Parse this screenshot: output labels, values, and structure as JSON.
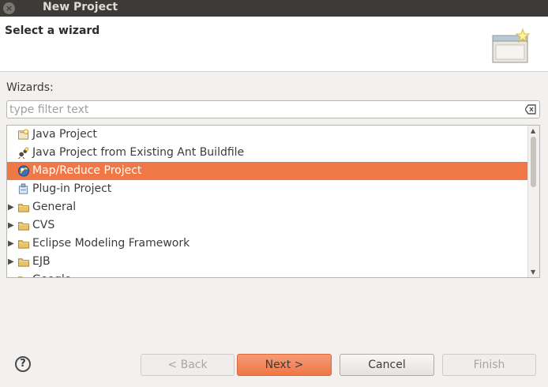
{
  "window": {
    "title": "New Project"
  },
  "header": {
    "title": "Select a wizard"
  },
  "wizards_label": "Wizards:",
  "filter": {
    "placeholder": "type filter text",
    "value": ""
  },
  "tree": {
    "items": [
      {
        "label": "Java Project",
        "icon": "java-project-icon",
        "expandable": false,
        "selected": false
      },
      {
        "label": "Java Project from Existing Ant Buildfile",
        "icon": "ant-icon",
        "expandable": false,
        "selected": false
      },
      {
        "label": "Map/Reduce Project",
        "icon": "mapreduce-icon",
        "expandable": false,
        "selected": true
      },
      {
        "label": "Plug-in Project",
        "icon": "plugin-icon",
        "expandable": false,
        "selected": false
      },
      {
        "label": "General",
        "icon": "folder-icon",
        "expandable": true,
        "selected": false
      },
      {
        "label": "CVS",
        "icon": "folder-icon",
        "expandable": true,
        "selected": false
      },
      {
        "label": "Eclipse Modeling Framework",
        "icon": "folder-icon",
        "expandable": true,
        "selected": false
      },
      {
        "label": "EJB",
        "icon": "folder-icon",
        "expandable": true,
        "selected": false
      },
      {
        "label": "Google",
        "icon": "folder-icon",
        "expandable": true,
        "selected": false
      }
    ]
  },
  "buttons": {
    "back": "< Back",
    "next": "Next >",
    "cancel": "Cancel",
    "finish": "Finish"
  },
  "colors": {
    "selection": "#f07746",
    "titlebar": "#3c3b37"
  }
}
